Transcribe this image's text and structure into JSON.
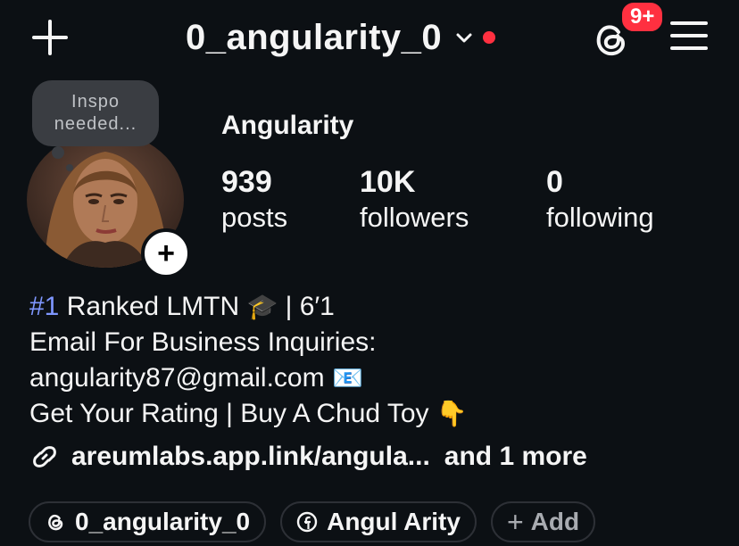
{
  "header": {
    "username": "0_angularity_0",
    "notification_badge": "9+",
    "icons": {
      "create": "plus-icon",
      "account_switch": "chevron-down-icon",
      "threads": "threads-icon",
      "menu": "hamburger-menu-icon"
    },
    "colors": {
      "badge": "#ff3040",
      "background": "#0c1014"
    }
  },
  "profile": {
    "note_text": "Inspo\nneeded...",
    "display_name": "Angularity",
    "stats": {
      "posts": {
        "value": "939",
        "label": "posts"
      },
      "followers": {
        "value": "10K",
        "label": "followers"
      },
      "following": {
        "value": "0",
        "label": "following"
      }
    }
  },
  "bio": {
    "line1_hashtag": "#1",
    "line1_text": " Ranked LMTN ",
    "line1_emoji": "🎓",
    "line1_suffix": " | 6′1",
    "line2": "Email For Business Inquiries:",
    "line3_text": "angularity87@gmail.com ",
    "line3_emoji": "📧",
    "line4_text": "Get Your Rating | Buy A Chud Toy ",
    "line4_emoji": "👇",
    "link": "areumlabs.app.link/angula...",
    "link_more": "and 1 more",
    "hashtag_color": "#7f97ff"
  },
  "chips": {
    "threads": "0_angularity_0",
    "facebook": "Angul Arity",
    "add": "Add"
  }
}
